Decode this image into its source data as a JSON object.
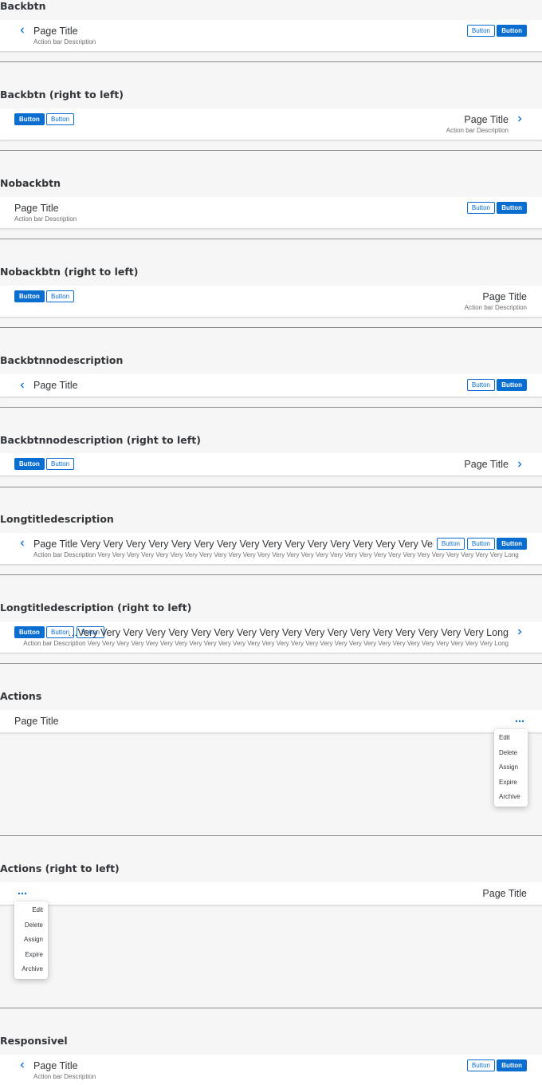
{
  "sections": {
    "backbtn": "Backbtn",
    "backbtn_rtl": "Backbtn (right to left)",
    "nobackbtn": "Nobackbtn",
    "nobackbtn_rtl": "Nobackbtn (right to left)",
    "backbtnnodescription": "Backbtnnodescription",
    "backbtnnodescription_rtl": "Backbtnnodescription (right to left)",
    "longtitledescription": "Longtitledescription",
    "longtitledescription_rtl": "Longtitledescription (right to left)",
    "actions": "Actions",
    "actions_rtl": "Actions (right to left)",
    "responsive": "Responsivel"
  },
  "bar": {
    "title": "Page Title",
    "description": "Action bar Description",
    "button": "Button",
    "long_title": "Page Title Very Very Very Very Very Very Very Very Very Very Very Very Very Very Very Very Very…",
    "long_description": "Action bar Description Very Very Very Very Very Very Very Very Very Very Very Very Very Very Very Very Very Very Very Very Very Very Very Very Very Very Very Very Long",
    "long_title_rtl": "…Very Very Very Very Very Very Very Very Very Very Very Very Very Very Very Very Very Very Long",
    "long_description_rtl": "Action bar Description Very Very Very Very Very Very Very Very Very Very Very Very Very Very Very Very Very Very Very Very Very Very Very Very Very Very Very Very Long"
  },
  "menu": {
    "items": [
      "Edit",
      "Delete",
      "Assign",
      "Expire",
      "Archive"
    ]
  },
  "icons": {
    "back": "chevron-left-icon",
    "back_rtl": "chevron-right-icon",
    "overflow": "overflow-icon"
  },
  "colors": {
    "accent": "#0a6ed1",
    "background": "#f6f6f6",
    "bar": "#ffffff",
    "text": "#32363a",
    "muted": "#6a6d70"
  }
}
